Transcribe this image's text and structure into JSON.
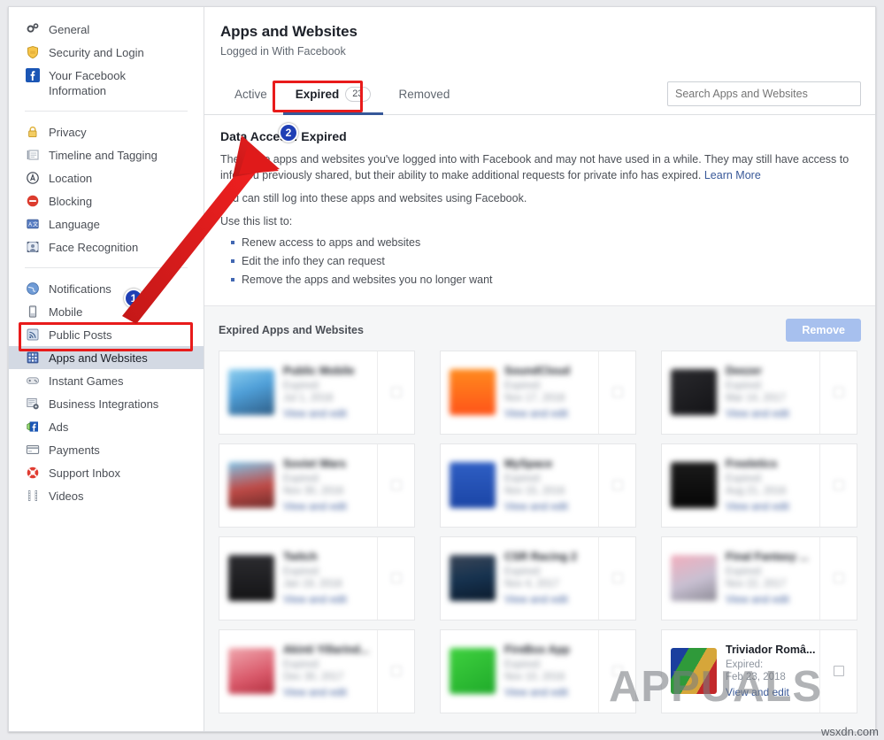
{
  "sidebar": {
    "groups": [
      {
        "items": [
          {
            "label": "General",
            "icon": "gears-icon",
            "name": "general",
            "selected": false
          },
          {
            "label": "Security and Login",
            "icon": "shield-icon",
            "name": "security-and-login",
            "selected": false
          },
          {
            "label": "Your Facebook Information",
            "icon": "facebook-icon",
            "name": "your-facebook-information",
            "selected": false
          }
        ]
      },
      {
        "items": [
          {
            "label": "Privacy",
            "icon": "lock-icon",
            "name": "privacy",
            "selected": false
          },
          {
            "label": "Timeline and Tagging",
            "icon": "timeline-icon",
            "name": "timeline-and-tagging",
            "selected": false
          },
          {
            "label": "Location",
            "icon": "location-icon",
            "name": "location",
            "selected": false
          },
          {
            "label": "Blocking",
            "icon": "block-icon",
            "name": "blocking",
            "selected": false
          },
          {
            "label": "Language",
            "icon": "language-icon",
            "name": "language",
            "selected": false
          },
          {
            "label": "Face Recognition",
            "icon": "face-icon",
            "name": "face-recognition",
            "selected": false
          }
        ]
      },
      {
        "items": [
          {
            "label": "Notifications",
            "icon": "globe-icon",
            "name": "notifications",
            "selected": false
          },
          {
            "label": "Mobile",
            "icon": "mobile-icon",
            "name": "mobile",
            "selected": false
          },
          {
            "label": "Public Posts",
            "icon": "rss-icon",
            "name": "public-posts",
            "selected": false
          },
          {
            "label": "Apps and Websites",
            "icon": "apps-icon",
            "name": "apps-and-websites",
            "selected": true
          },
          {
            "label": "Instant Games",
            "icon": "gamepad-icon",
            "name": "instant-games",
            "selected": false
          },
          {
            "label": "Business Integrations",
            "icon": "business-icon",
            "name": "business-integrations",
            "selected": false
          },
          {
            "label": "Ads",
            "icon": "ads-icon",
            "name": "ads",
            "selected": false
          },
          {
            "label": "Payments",
            "icon": "payments-icon",
            "name": "payments",
            "selected": false
          },
          {
            "label": "Support Inbox",
            "icon": "lifebuoy-icon",
            "name": "support-inbox",
            "selected": false
          },
          {
            "label": "Videos",
            "icon": "film-icon",
            "name": "videos",
            "selected": false
          }
        ]
      }
    ]
  },
  "header": {
    "title": "Apps and Websites",
    "subtitle": "Logged in With Facebook"
  },
  "tabs": [
    {
      "label": "Active",
      "count": "",
      "active": false
    },
    {
      "label": "Expired",
      "count": "23",
      "active": true
    },
    {
      "label": "Removed",
      "count": "",
      "active": false
    }
  ],
  "search": {
    "placeholder": "Search Apps and Websites",
    "value": ""
  },
  "description": {
    "heading": "Data Access: Expired",
    "para1": "These are apps and websites you've logged into with Facebook and may not have used in a while. They may still have access to info you previously shared, but their ability to make additional requests for private info has expired.",
    "learn_more": "Learn More",
    "para2": "You can still log into these apps and websites using Facebook.",
    "use_list_label": "Use this list to:",
    "bullets": [
      "Renew access to apps and websites",
      "Edit the info they can request",
      "Remove the apps and websites you no longer want"
    ]
  },
  "list_section": {
    "title": "Expired Apps and Websites",
    "remove_label": "Remove",
    "expired_prefix": "Expired:",
    "view_and_edit_label": "View and edit",
    "cards": [
      {
        "name": "Public Mobile",
        "expired_date": "Jul 1, 2018",
        "blurred": true,
        "thumb": "photo-blue"
      },
      {
        "name": "SoundCloud",
        "expired_date": "Nov 17, 2018",
        "blurred": true,
        "thumb": "soundcloud-orange"
      },
      {
        "name": "Deezer",
        "expired_date": "Mar 14, 2017",
        "blurred": true,
        "thumb": "deezer-dark"
      },
      {
        "name": "Soviet Wars",
        "expired_date": "Nov 30, 2016",
        "blurred": true,
        "thumb": "soviet-red"
      },
      {
        "name": "MySpace",
        "expired_date": "Nov 15, 2016",
        "blurred": true,
        "thumb": "myspace-blue"
      },
      {
        "name": "Freeletics",
        "expired_date": "Aug 21, 2016",
        "blurred": true,
        "thumb": "freeletics-black"
      },
      {
        "name": "Twitch",
        "expired_date": "Jan 19, 2018",
        "blurred": true,
        "thumb": "twitch-dark"
      },
      {
        "name": "CSR Racing 2",
        "expired_date": "Nov 4, 2017",
        "blurred": true,
        "thumb": "csr-car"
      },
      {
        "name": "Final Fantasy ...",
        "expired_date": "Nov 22, 2017",
        "blurred": true,
        "thumb": "ff-pink"
      },
      {
        "name": "Akinti Yillarind...",
        "expired_date": "Dec 30, 2017",
        "blurred": true,
        "thumb": "akinti-red"
      },
      {
        "name": "FireBox App",
        "expired_date": "Nov 10, 2016",
        "blurred": true,
        "thumb": "firebox-green"
      },
      {
        "name": "Triviador Româ...",
        "expired_date": "Feb 23, 2018",
        "blurred": false,
        "thumb": "triviador"
      }
    ]
  },
  "annotations": {
    "marker1": "1",
    "marker2": "2"
  },
  "watermarks": {
    "main": "APPUALS",
    "corner": "wsxdn.com"
  },
  "colors": {
    "accent_blue": "#365899",
    "link_blue": "#385898",
    "annotation_red": "#e81b1b",
    "marker_blue": "#1f3fb5",
    "remove_button": "#a7c0ee"
  }
}
